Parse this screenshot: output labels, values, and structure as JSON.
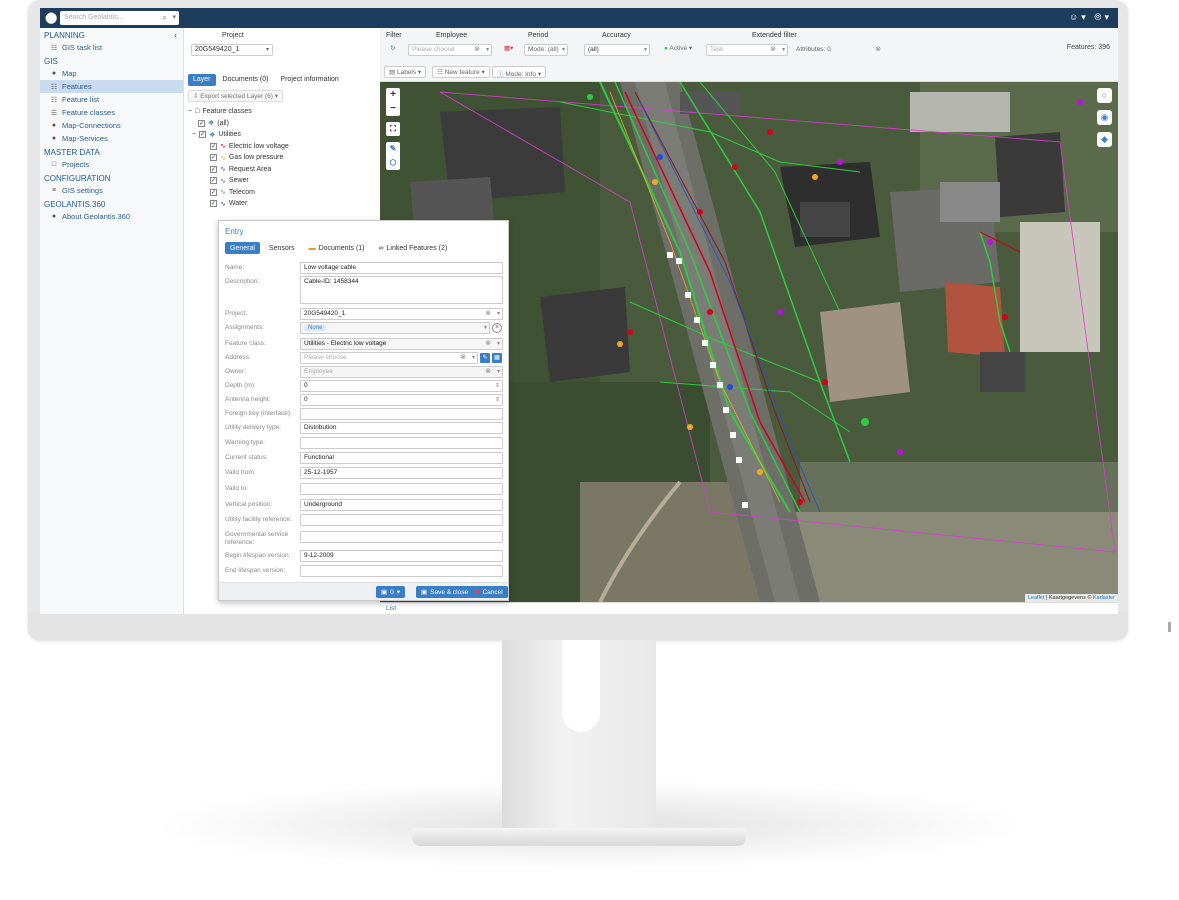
{
  "topbar": {
    "search_placeholder": "Search Geolantis..."
  },
  "sidebar": {
    "sections": [
      {
        "title": "PLANNING",
        "items": [
          {
            "label": "GIS task list",
            "icon": "tasklist-icon"
          }
        ]
      },
      {
        "title": "GIS",
        "items": [
          {
            "label": "Map",
            "icon": "map-pin-icon"
          },
          {
            "label": "Features",
            "icon": "features-icon",
            "active": true
          },
          {
            "label": "Feature list",
            "icon": "feature-list-icon"
          },
          {
            "label": "Feature classes",
            "icon": "feature-classes-icon"
          },
          {
            "label": "Map-Connections",
            "icon": "globe-icon"
          },
          {
            "label": "Map-Services",
            "icon": "globe-icon"
          }
        ]
      },
      {
        "title": "MASTER DATA",
        "items": [
          {
            "label": "Projects",
            "icon": "folder-icon"
          }
        ]
      },
      {
        "title": "CONFIGURATION",
        "items": [
          {
            "label": "GIS settings",
            "icon": "settings-icon"
          }
        ]
      },
      {
        "title": "GEOLANTIS.360",
        "items": [
          {
            "label": "About Geolantis.360",
            "icon": "info-icon"
          }
        ]
      }
    ]
  },
  "midpane": {
    "project_label": "Project",
    "project_value": "20G549420_1",
    "tabs": [
      "Layer",
      "Documents (0)",
      "Project information"
    ],
    "export_label": "Export selected Layer (6)",
    "tree": {
      "root": "Feature classes",
      "all": "(all)",
      "group": "Utilities",
      "layers": [
        {
          "label": "Electric low voltage",
          "color": "#d0021b"
        },
        {
          "label": "Gas low pressure",
          "color": "#f5a623"
        },
        {
          "label": "Request Area",
          "color": "#bd10e0"
        },
        {
          "label": "Sewer",
          "color": "#8b572a"
        },
        {
          "label": "Telecom",
          "color": "#2ecc40"
        },
        {
          "label": "Water",
          "color": "#1e4fd8"
        }
      ]
    }
  },
  "filterbar": {
    "filter_label": "Filter",
    "employee_label": "Employee",
    "employee_placeholder": "Please choose",
    "period_label": "Period",
    "period_mode": "Mode: (all)",
    "accuracy_label": "Accuracy",
    "accuracy_value": "(all)",
    "active_label": "Active",
    "task_placeholder": "Task",
    "extended_label": "Extended filter",
    "attributes_label": "Attributes: 0",
    "features_count": "Features: 396",
    "labels_btn": "Labels",
    "new_feature_btn": "New feature",
    "mode_info_btn": "Mode: Info"
  },
  "map": {
    "attribution_leaflet": "Leaflet",
    "attribution_rest": "| Kaartgegevens ©",
    "attribution_kadaster": "Kadaster"
  },
  "list_bar": {
    "label": "List"
  },
  "dialog": {
    "title": "Entry",
    "tabs": [
      "General",
      "Sensors",
      "Documents (1)",
      "Linked Features (2)"
    ],
    "fields": {
      "name": {
        "label": "Name:",
        "value": "Low voltage cable"
      },
      "description": {
        "label": "Description:",
        "value": "Cable-ID: 1458344"
      },
      "project": {
        "label": "Project:",
        "value": "20G549420_1"
      },
      "assignments": {
        "label": "Assignments:",
        "value": "None"
      },
      "feature_class": {
        "label": "Feature class:",
        "value": "Utilities - Electric low voltage"
      },
      "address": {
        "label": "Address:",
        "placeholder": "Please choose"
      },
      "owner": {
        "label": "Owner:",
        "placeholder": "Employee"
      },
      "depth": {
        "label": "Depth (m):",
        "value": "0"
      },
      "antenna": {
        "label": "Antenna height:",
        "value": "0"
      },
      "foreign_key": {
        "label": "Foreign key (interface):",
        "value": ""
      },
      "utility_delivery": {
        "label": "Utility delivery type:",
        "value": "Distribution"
      },
      "warning_type": {
        "label": "Warning type:",
        "value": ""
      },
      "current_status": {
        "label": "Current status:",
        "value": "Functional"
      },
      "valid_from": {
        "label": "Valid from:",
        "value": "25-12-1957"
      },
      "valid_to": {
        "label": "Valid to:",
        "value": ""
      },
      "vertical_position": {
        "label": "Vertical position:",
        "value": "Underground"
      },
      "utility_facility_ref": {
        "label": "Utility facility reference:",
        "value": ""
      },
      "governmental_ref": {
        "label": "Governmental service reference:",
        "value": ""
      },
      "begin_lifespan": {
        "label": "Begin lifespan version:",
        "value": "9-12-2009"
      },
      "end_lifespan": {
        "label": "End lifespan version:",
        "value": ""
      }
    },
    "footer": {
      "count": "0",
      "save_close": "Save & close",
      "cancel": "Cancel"
    }
  }
}
